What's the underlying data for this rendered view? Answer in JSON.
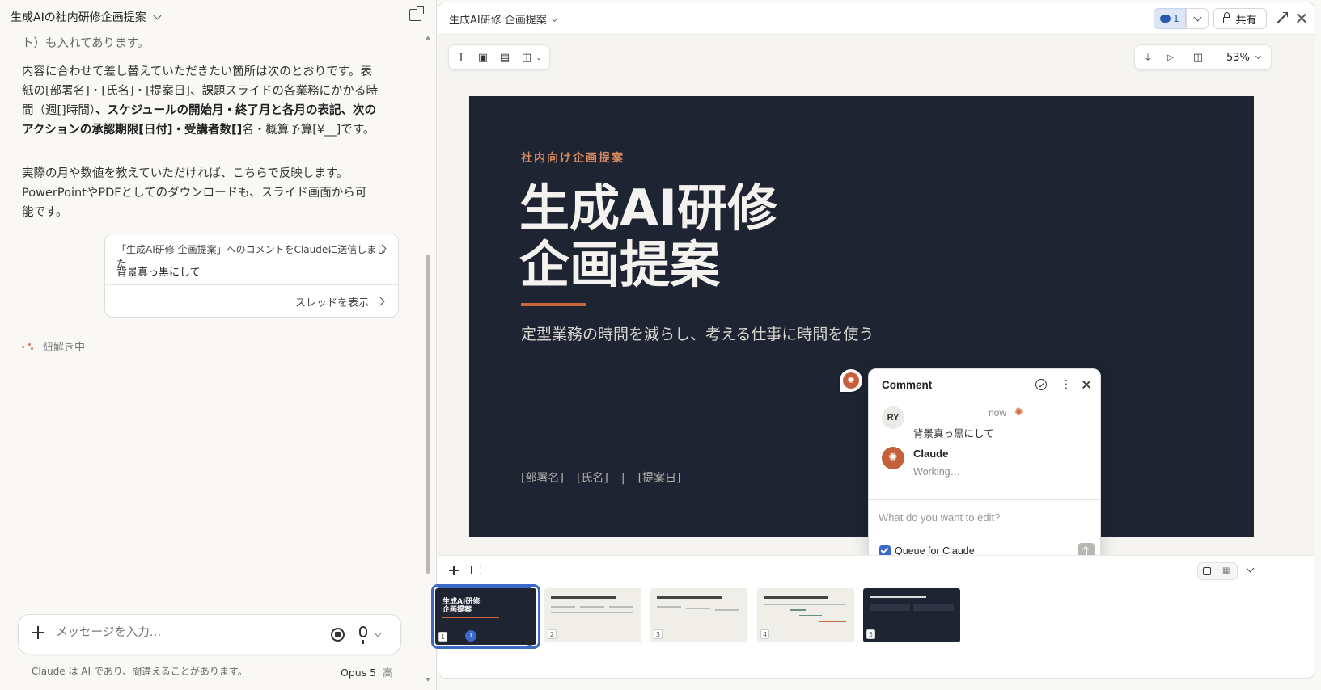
{
  "chat": {
    "title": "生成AIの社内研修企画提案",
    "p0": "ト）も入れてあります。",
    "p1_a": "内容に合わせて差し替えていただきたい箇所は次のとおりです。表紙の[部署名]・[氏名]・[提案日]、課題スライドの各業務にかかる時間（週[]時間）",
    "p1_b": "、スケジュールの開始月・終了月と各月の表記、次のアクションの承認期限[日付]・受講者数[]",
    "p1_c": "名・概算予算[¥__]です。",
    "p2": "実際の月や数値を教えていただければ、こちらで反映します。PowerPointやPDFとしてのダウンロードも、スライド画面から可能です。",
    "comment_card": {
      "header": "「生成AI研修 企画提案」へのコメントをClaudeに送信しました",
      "text": "背景真っ黒にして",
      "thread_link": "スレッドを表示"
    },
    "status": "紐解き中",
    "input_placeholder": "メッセージを入力…",
    "footer_note": "Claude は AI であり、間違えることがあります。",
    "model": "Opus 5",
    "effort": "高"
  },
  "artifact": {
    "title": "生成AI研修 企画提案",
    "comment_count": "1",
    "share_label": "共有",
    "zoom": "53%",
    "slide": {
      "kicker": "社内向け企画提案",
      "title_line1": "生成AI研修",
      "title_line2": "企画提案",
      "subtitle": "定型業務の時間を減らし、考える仕事に時間を使う",
      "dept": "[部署名]",
      "name": "[氏名]",
      "sep": "|",
      "date": "[提案日]"
    },
    "comment_popup": {
      "title": "Comment",
      "author_initials": "RY",
      "time": "now",
      "message": "背景真っ黒にして",
      "reply_name": "Claude",
      "reply_status": "Working…",
      "input_placeholder": "What do you want to edit?",
      "queue_label": "Queue for Claude"
    },
    "thumbnails": [
      {
        "num": "1",
        "title": "生成AI研修\n企画提案",
        "badge": "1"
      },
      {
        "num": "2"
      },
      {
        "num": "3"
      },
      {
        "num": "4"
      },
      {
        "num": "5"
      }
    ]
  },
  "colors": {
    "slide_bg": "#1f2432",
    "accent": "#c9673e",
    "selection": "#3b69c7"
  }
}
